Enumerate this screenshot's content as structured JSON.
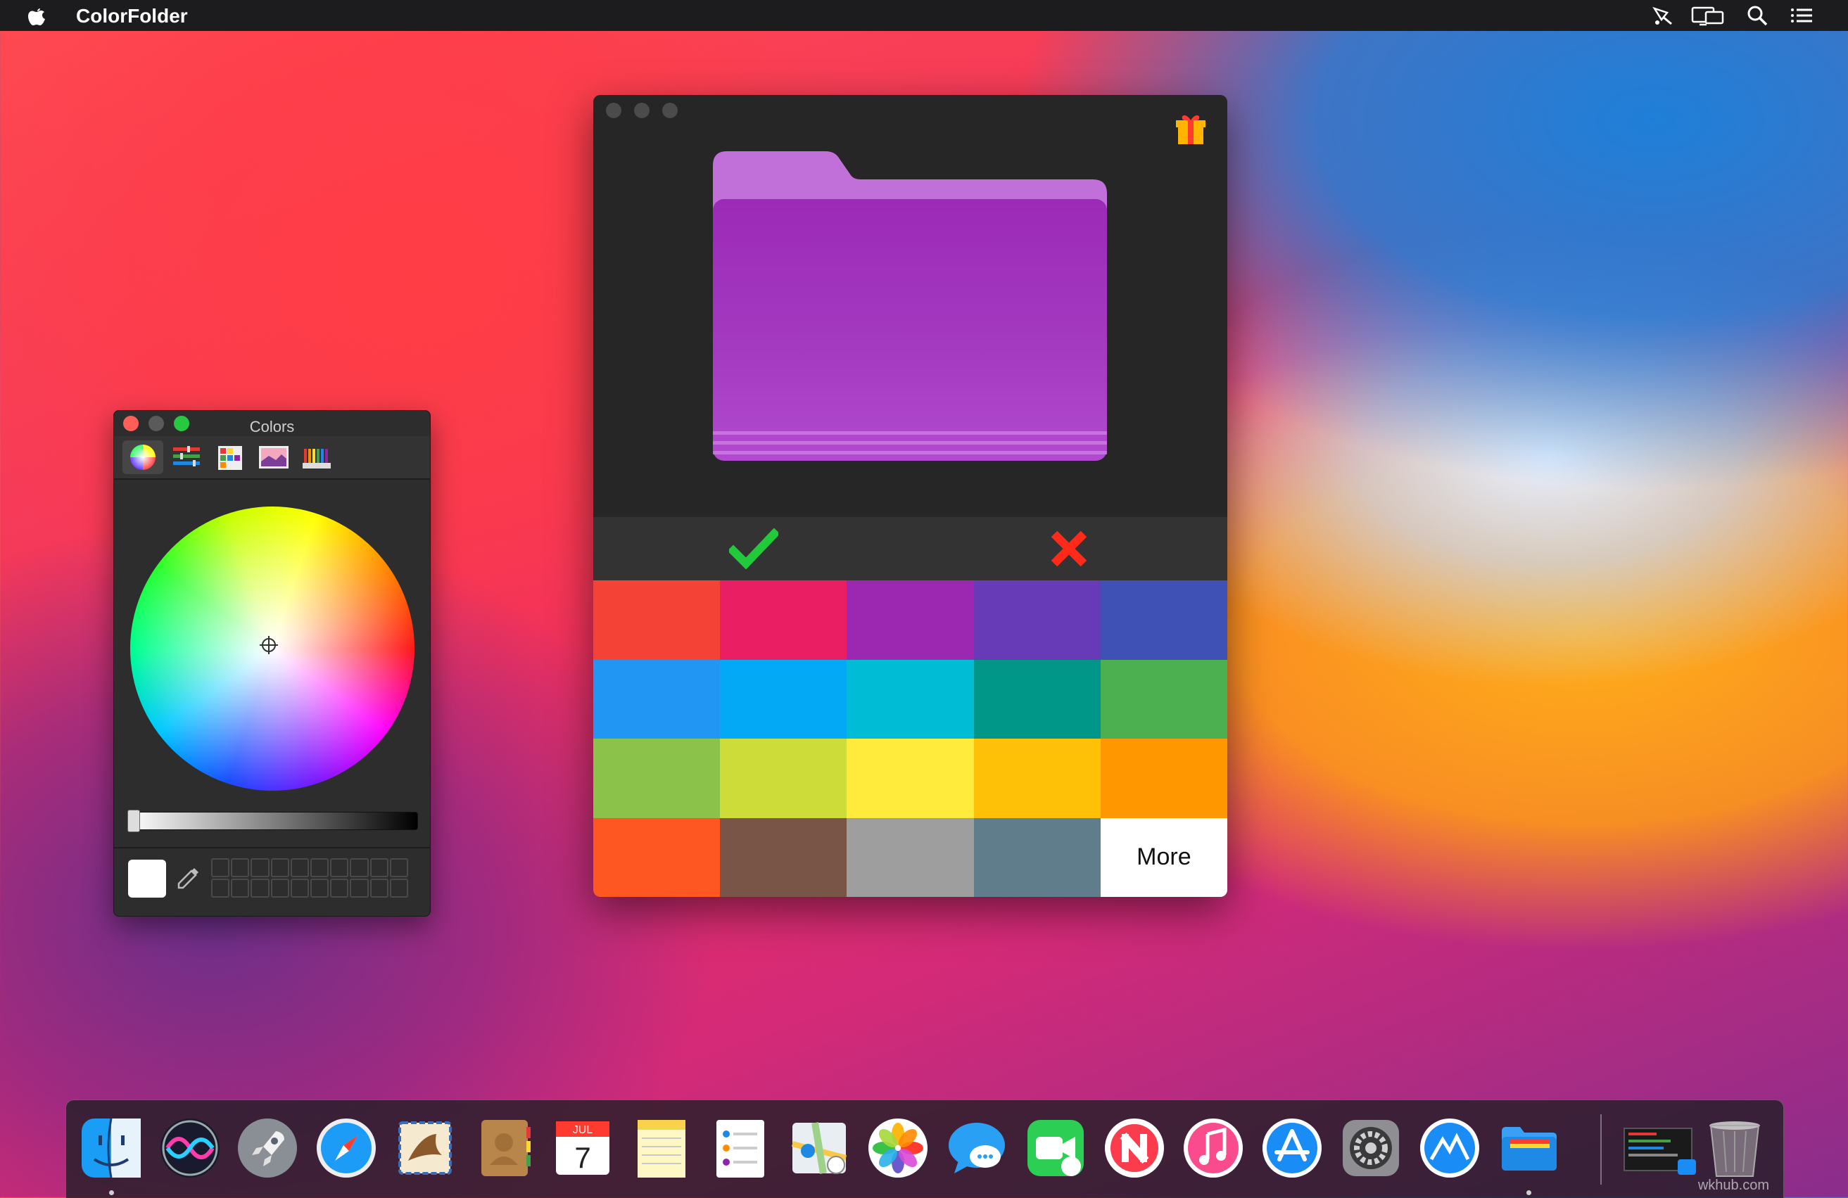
{
  "menubar": {
    "app_name": "ColorFolder",
    "icons": [
      "apple-icon",
      "paint-bucket-icon",
      "display-icon",
      "search-icon",
      "list-icon"
    ]
  },
  "colorfolder_window": {
    "folder_color": "#a43bc0",
    "folder_name": "",
    "gift_icon": "gift-icon",
    "confirm_icon": "checkmark-icon",
    "cancel_icon": "x-mark-icon",
    "palette": [
      "#f44336",
      "#e91e63",
      "#9c27b0",
      "#673ab7",
      "#3f51b5",
      "#2196f3",
      "#03a9f4",
      "#00bcd4",
      "#009688",
      "#4caf50",
      "#8bc34a",
      "#cddc39",
      "#ffeb3b",
      "#ffc107",
      "#ff9800",
      "#ff5722",
      "#795548",
      "#9e9e9e",
      "#607d8b"
    ],
    "more_label": "More"
  },
  "colors_panel": {
    "title": "Colors",
    "tabs": [
      "color-wheel-icon",
      "sliders-icon",
      "palettes-icon",
      "image-palette-icon",
      "pencils-icon"
    ],
    "selected_tab": 0,
    "current_color": "#ffffff",
    "brightness": 1.0
  },
  "dock": {
    "apps": [
      "Finder",
      "Siri",
      "Launchpad",
      "Safari",
      "Mail",
      "Contacts",
      "Calendar",
      "Notes",
      "Reminders",
      "Maps",
      "Photos",
      "Messages",
      "FaceTime",
      "News",
      "Music",
      "App Store",
      "System Preferences",
      "Camo",
      "ColorFolder"
    ],
    "calendar_month": "JUL",
    "calendar_day": "7",
    "extras": [
      "Screenshot",
      "Trash"
    ]
  },
  "watermark": "wkhub.com"
}
